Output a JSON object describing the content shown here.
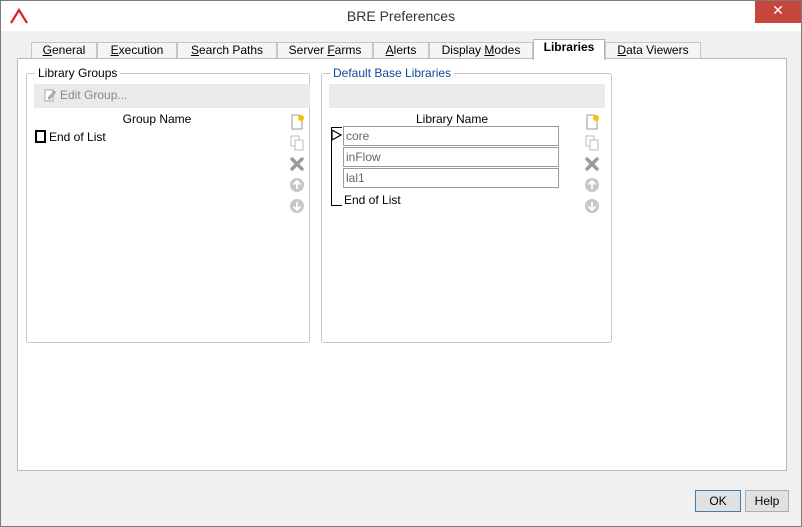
{
  "window": {
    "title": "BRE Preferences",
    "close_label": "✕"
  },
  "tabs": [
    {
      "label": "General",
      "acc": "G",
      "rest": "eneral"
    },
    {
      "label": "Execution",
      "acc": "E",
      "rest": "xecution"
    },
    {
      "label": "Search Paths",
      "acc": "S",
      "rest": "earch Paths"
    },
    {
      "label": "Server Farms",
      "pre": "Server ",
      "acc": "F",
      "rest": "arms"
    },
    {
      "label": "Alerts",
      "acc": "A",
      "rest": "lerts"
    },
    {
      "label": "Display Modes",
      "pre": "Display ",
      "acc": "M",
      "rest": "odes"
    },
    {
      "label": "Libraries",
      "pre": "",
      "acc": "",
      "rest": "Libraries"
    },
    {
      "label": "Data Viewers",
      "pre": "",
      "acc": "D",
      "rest": "ata Viewers"
    }
  ],
  "library_groups": {
    "title": "Library Groups",
    "edit_group_label": "Edit Group...",
    "column_header": "Group Name",
    "end_of_list": "End of List"
  },
  "default_base_libraries": {
    "title": "Default Base Libraries",
    "column_header": "Library Name",
    "rows": [
      "core",
      "inFlow",
      "lal1"
    ],
    "end_of_list": "End of List"
  },
  "buttons": {
    "ok": "OK",
    "help": "Help"
  },
  "colors": {
    "accent_blue": "#0d4a9c",
    "close_red": "#c7463b",
    "new_icon_yellow": "#f5c400"
  }
}
